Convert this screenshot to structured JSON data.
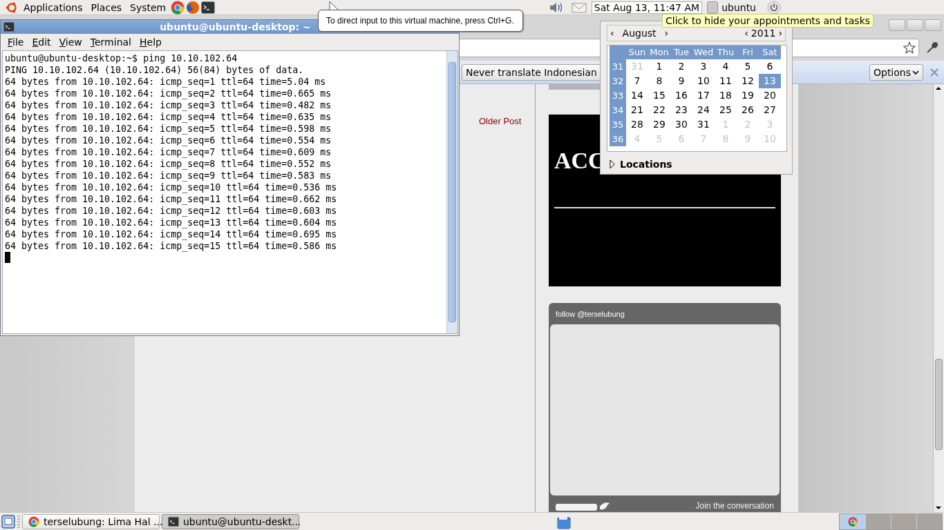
{
  "top_panel": {
    "menus": [
      "Applications",
      "Places",
      "System"
    ],
    "clock": "Sat Aug 13, 11:47 AM",
    "user": "ubuntu"
  },
  "vm_tooltip": "To direct input to this virtual machine, press Ctrl+G.",
  "browser": {
    "translate_button": "Never translate Indonesian",
    "options_button": "Options",
    "older_post": "Older Post",
    "banner_text": "ACC",
    "twitter_widget": {
      "header": "follow @terselubung",
      "footer": "Join the conversation"
    }
  },
  "terminal": {
    "title": "ubuntu@ubuntu-desktop: ~",
    "menu": [
      "File",
      "Edit",
      "View",
      "Terminal",
      "Help"
    ],
    "lines": [
      "ubuntu@ubuntu-desktop:~$ ping 10.10.102.64",
      "PING 10.10.102.64 (10.10.102.64) 56(84) bytes of data.",
      "64 bytes from 10.10.102.64: icmp_seq=1 ttl=64 time=5.04 ms",
      "64 bytes from 10.10.102.64: icmp_seq=2 ttl=64 time=0.665 ms",
      "64 bytes from 10.10.102.64: icmp_seq=3 ttl=64 time=0.482 ms",
      "64 bytes from 10.10.102.64: icmp_seq=4 ttl=64 time=0.635 ms",
      "64 bytes from 10.10.102.64: icmp_seq=5 ttl=64 time=0.598 ms",
      "64 bytes from 10.10.102.64: icmp_seq=6 ttl=64 time=0.554 ms",
      "64 bytes from 10.10.102.64: icmp_seq=7 ttl=64 time=0.609 ms",
      "64 bytes from 10.10.102.64: icmp_seq=8 ttl=64 time=0.552 ms",
      "64 bytes from 10.10.102.64: icmp_seq=9 ttl=64 time=0.583 ms",
      "64 bytes from 10.10.102.64: icmp_seq=10 ttl=64 time=0.536 ms",
      "64 bytes from 10.10.102.64: icmp_seq=11 ttl=64 time=0.662 ms",
      "64 bytes from 10.10.102.64: icmp_seq=12 ttl=64 time=0.603 ms",
      "64 bytes from 10.10.102.64: icmp_seq=13 ttl=64 time=0.604 ms",
      "64 bytes from 10.10.102.64: icmp_seq=14 ttl=64 time=0.695 ms",
      "64 bytes from 10.10.102.64: icmp_seq=15 ttl=64 time=0.586 ms"
    ]
  },
  "calendar": {
    "prev_month": "‹",
    "month": "August",
    "next_month": "›",
    "prev_year": "‹",
    "year": "2011",
    "next_year": "›",
    "weekdays": [
      "Sun",
      "Mon",
      "Tue",
      "Wed",
      "Thu",
      "Fri",
      "Sat"
    ],
    "weeks": [
      {
        "number": "31",
        "days": [
          {
            "label": "31",
            "outside": true,
            "selected": false
          },
          {
            "label": "1",
            "outside": false,
            "selected": false
          },
          {
            "label": "2",
            "outside": false,
            "selected": false
          },
          {
            "label": "3",
            "outside": false,
            "selected": false
          },
          {
            "label": "4",
            "outside": false,
            "selected": false
          },
          {
            "label": "5",
            "outside": false,
            "selected": false
          },
          {
            "label": "6",
            "outside": false,
            "selected": false
          }
        ]
      },
      {
        "number": "32",
        "days": [
          {
            "label": "7",
            "outside": false,
            "selected": false
          },
          {
            "label": "8",
            "outside": false,
            "selected": false
          },
          {
            "label": "9",
            "outside": false,
            "selected": false
          },
          {
            "label": "10",
            "outside": false,
            "selected": false
          },
          {
            "label": "11",
            "outside": false,
            "selected": false
          },
          {
            "label": "12",
            "outside": false,
            "selected": false
          },
          {
            "label": "13",
            "outside": false,
            "selected": true
          }
        ]
      },
      {
        "number": "33",
        "days": [
          {
            "label": "14",
            "outside": false,
            "selected": false
          },
          {
            "label": "15",
            "outside": false,
            "selected": false
          },
          {
            "label": "16",
            "outside": false,
            "selected": false
          },
          {
            "label": "17",
            "outside": false,
            "selected": false
          },
          {
            "label": "18",
            "outside": false,
            "selected": false
          },
          {
            "label": "19",
            "outside": false,
            "selected": false
          },
          {
            "label": "20",
            "outside": false,
            "selected": false
          }
        ]
      },
      {
        "number": "34",
        "days": [
          {
            "label": "21",
            "outside": false,
            "selected": false
          },
          {
            "label": "22",
            "outside": false,
            "selected": false
          },
          {
            "label": "23",
            "outside": false,
            "selected": false
          },
          {
            "label": "24",
            "outside": false,
            "selected": false
          },
          {
            "label": "25",
            "outside": false,
            "selected": false
          },
          {
            "label": "26",
            "outside": false,
            "selected": false
          },
          {
            "label": "27",
            "outside": false,
            "selected": false
          }
        ]
      },
      {
        "number": "35",
        "days": [
          {
            "label": "28",
            "outside": false,
            "selected": false
          },
          {
            "label": "29",
            "outside": false,
            "selected": false
          },
          {
            "label": "30",
            "outside": false,
            "selected": false
          },
          {
            "label": "31",
            "outside": false,
            "selected": false
          },
          {
            "label": "1",
            "outside": true,
            "selected": false
          },
          {
            "label": "2",
            "outside": true,
            "selected": false
          },
          {
            "label": "3",
            "outside": true,
            "selected": false
          }
        ]
      },
      {
        "number": "36",
        "days": [
          {
            "label": "4",
            "outside": true,
            "selected": false
          },
          {
            "label": "5",
            "outside": true,
            "selected": false
          },
          {
            "label": "6",
            "outside": true,
            "selected": false
          },
          {
            "label": "7",
            "outside": true,
            "selected": false
          },
          {
            "label": "8",
            "outside": true,
            "selected": false
          },
          {
            "label": "9",
            "outside": true,
            "selected": false
          },
          {
            "label": "10",
            "outside": true,
            "selected": false
          }
        ]
      }
    ],
    "locations": {
      "label": "Locations",
      "expanded": false
    }
  },
  "calendar_tooltip": "Click to hide your appointments and tasks",
  "taskbar": {
    "tasks": [
      {
        "label": "terselubung: Lima Hal ...",
        "kind": "browser",
        "selected": false
      },
      {
        "label": "ubuntu@ubuntu-deskt...",
        "kind": "terminal",
        "selected": true
      }
    ],
    "workspaces": [
      {
        "selected": true
      },
      {
        "selected": false
      },
      {
        "selected": false
      },
      {
        "selected": false
      }
    ]
  }
}
